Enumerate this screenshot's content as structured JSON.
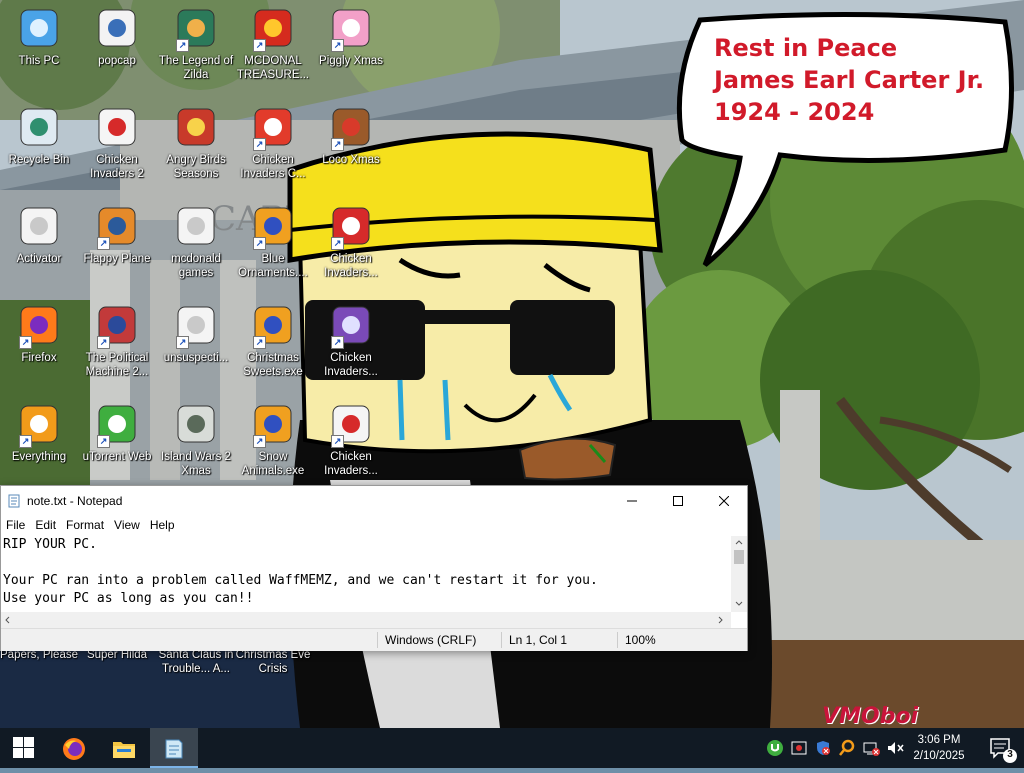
{
  "bubble": {
    "line1": "Rest in Peace",
    "line2": "James Earl Carter Jr.",
    "line3": "1924 - 2024"
  },
  "watermark": "VMOboi",
  "desktop_icons": [
    {
      "label": "This PC",
      "icon": "computer-icon",
      "shortcut": false
    },
    {
      "label": "popcap",
      "icon": "folder-icon",
      "shortcut": false
    },
    {
      "label": "The Legend of Zilda",
      "icon": "game-character-icon",
      "shortcut": true
    },
    {
      "label": "MCDONAL TREASURE...",
      "icon": "mcdonalds-logo-icon",
      "shortcut": true
    },
    {
      "label": "Piggly Xmas",
      "icon": "pig-icon",
      "shortcut": true
    },
    {
      "label": "Recycle Bin",
      "icon": "recycle-bin-icon",
      "shortcut": false
    },
    {
      "label": "Chicken Invaders 2",
      "icon": "chicken-icon",
      "shortcut": false
    },
    {
      "label": "Angry Birds Seasons",
      "icon": "angry-bird-icon",
      "shortcut": false
    },
    {
      "label": "Chicken Invaders C...",
      "icon": "snowman-icon",
      "shortcut": true
    },
    {
      "label": "Loco Xmas",
      "icon": "teddy-bear-icon",
      "shortcut": true
    },
    {
      "label": "Activator",
      "icon": "document-icon",
      "shortcut": false
    },
    {
      "label": "Flappy Plane",
      "icon": "plane-game-icon",
      "shortcut": true
    },
    {
      "label": "mcdonald games",
      "icon": "document-icon",
      "shortcut": false
    },
    {
      "label": "Blue Ornaments....",
      "icon": "puzzle-game-icon",
      "shortcut": true
    },
    {
      "label": "Chicken Invaders...",
      "icon": "chicken-santa-icon",
      "shortcut": true
    },
    {
      "label": "Firefox",
      "icon": "firefox-icon",
      "shortcut": true
    },
    {
      "label": "The Political Machine 2...",
      "icon": "political-machine-icon",
      "shortcut": true
    },
    {
      "label": "unsuspecti...",
      "icon": "document-icon",
      "shortcut": true
    },
    {
      "label": "Christmas Sweets.exe",
      "icon": "puzzle-game-icon",
      "shortcut": true
    },
    {
      "label": "Chicken Invaders...",
      "icon": "ufo-icon",
      "shortcut": true
    },
    {
      "label": "Everything",
      "icon": "search-icon",
      "shortcut": true
    },
    {
      "label": "uTorrent Web",
      "icon": "utorrent-icon",
      "shortcut": true
    },
    {
      "label": "Island Wars 2 Xmas",
      "icon": "island-game-icon",
      "shortcut": false
    },
    {
      "label": "Snow Animals.exe",
      "icon": "puzzle-game-icon",
      "shortcut": true
    },
    {
      "label": "Chicken Invaders...",
      "icon": "chicken-icon",
      "shortcut": true
    },
    {
      "label": "Papers, Please",
      "icon": "papers-please-icon",
      "shortcut": false
    },
    {
      "label": "Super Hilda",
      "icon": "game-character-icon",
      "shortcut": false
    },
    {
      "label": "Santa Claus in Trouble... A...",
      "icon": "santa-icon",
      "shortcut": false
    },
    {
      "label": "Christmas Eve Crisis",
      "icon": "christmas-icon",
      "shortcut": false
    }
  ],
  "notepad": {
    "title": "note.txt - Notepad",
    "menu": [
      "File",
      "Edit",
      "Format",
      "View",
      "Help"
    ],
    "lines": [
      "RIP YOUR PC.",
      "",
      "Your PC ran into a problem called WaffMEMZ, and we can't restart it for you.",
      "Use your PC as long as you can!!"
    ],
    "status": {
      "encoding": "Windows (CRLF)",
      "position": "Ln 1, Col 1",
      "zoom": "100%"
    }
  },
  "taskbar": {
    "time": "3:06 PM",
    "date": "2/10/2025",
    "notification_count": "3",
    "pinned": [
      "windows-start-icon",
      "firefox-icon",
      "file-explorer-icon",
      "notepad-icon"
    ]
  },
  "colors": {
    "bubble_text": "#d11a2a",
    "taskbar": "#111a24",
    "hat": "#f5e01c"
  }
}
